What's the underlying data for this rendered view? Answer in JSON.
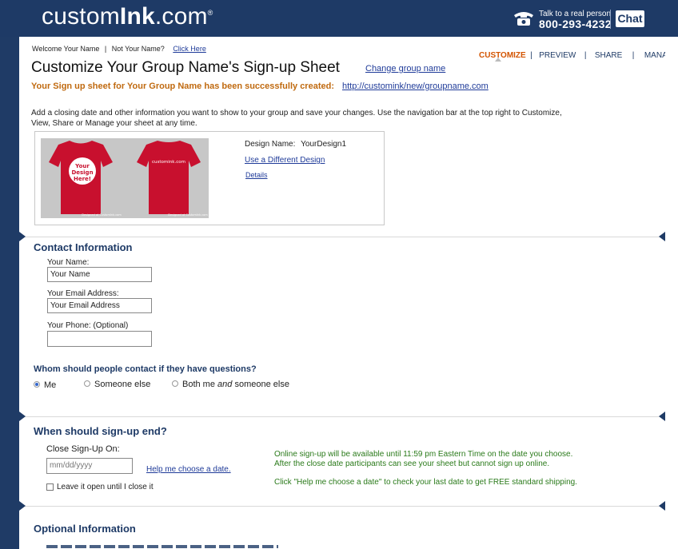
{
  "header": {
    "logo_pre": "custom",
    "logo_bold": "Ink",
    "logo_post": ".com",
    "logo_mark": "®",
    "talk_label": "Talk to a real person",
    "phone": "800-293-4232",
    "chat_label": "Chat"
  },
  "welcome": {
    "text": "Welcome Your Name",
    "sep": "|",
    "not_you": "Not Your Name?",
    "click_here": "Click Here"
  },
  "nav": {
    "items": [
      {
        "label": "CUSTOMIZE",
        "active": true
      },
      {
        "label": "PREVIEW",
        "active": false
      },
      {
        "label": "SHARE",
        "active": false
      },
      {
        "label": "MANAGE",
        "active": false
      }
    ],
    "sep": "|"
  },
  "title": "Customize Your Group Name's Sign-up Sheet",
  "change_group_name": "Change group name",
  "success_text": "Your Sign up sheet for Your Group Name has been successfully created:",
  "success_url": "http://customink/new/groupname.com",
  "intro": "Add a closing date and other information you want to show to your group and save your changes.  Use the navigation bar at the top right to Customize, View, Share or Manage your sheet at any time.",
  "design": {
    "name_label": "Design Name:",
    "name_value": "YourDesign1",
    "use_different": "Use a Different Design",
    "details": "Details",
    "shirt_front_text": "Your Design Here!",
    "shirt_back_text": "customink.com",
    "caption_front": "Designed at CustomInk.com",
    "caption_back": "Designed at CustomInk.com"
  },
  "contact": {
    "title": "Contact Information",
    "name_label": "Your Name:",
    "name_value": "Your Name",
    "email_label": "Your Email Address:",
    "email_value": "Your Email Address",
    "phone_label": "Your Phone: (Optional)",
    "phone_value": "",
    "question": "Whom should people contact if they have questions?",
    "options": [
      "Me",
      "Someone else",
      "Both me and someone else"
    ],
    "options_both_pre": "Both me ",
    "options_both_em": "and",
    "options_both_post": " someone else",
    "selected": "Me"
  },
  "signup_end": {
    "title": "When should sign-up end?",
    "close_label": "Close Sign-Up On:",
    "date_placeholder": "mm/dd/yyyy",
    "help_link": "Help me choose a date.",
    "leave_open_label": "Leave it open until I close it",
    "info_line1": "Online sign-up will be available until 11:59 pm Eastern Time on the date you choose.",
    "info_line2": "After the close date participants can see your sheet but cannot sign up online.",
    "info_line3": "Click \"Help me choose a date\" to check your last date to get FREE standard shipping."
  },
  "optional": {
    "title": "Optional Information"
  },
  "colors": {
    "navy": "#1e3a66",
    "accent_orange": "#c06a10",
    "link_blue": "#1f3b99",
    "info_green": "#2a7a1a",
    "shirt_red": "#c8102e"
  }
}
